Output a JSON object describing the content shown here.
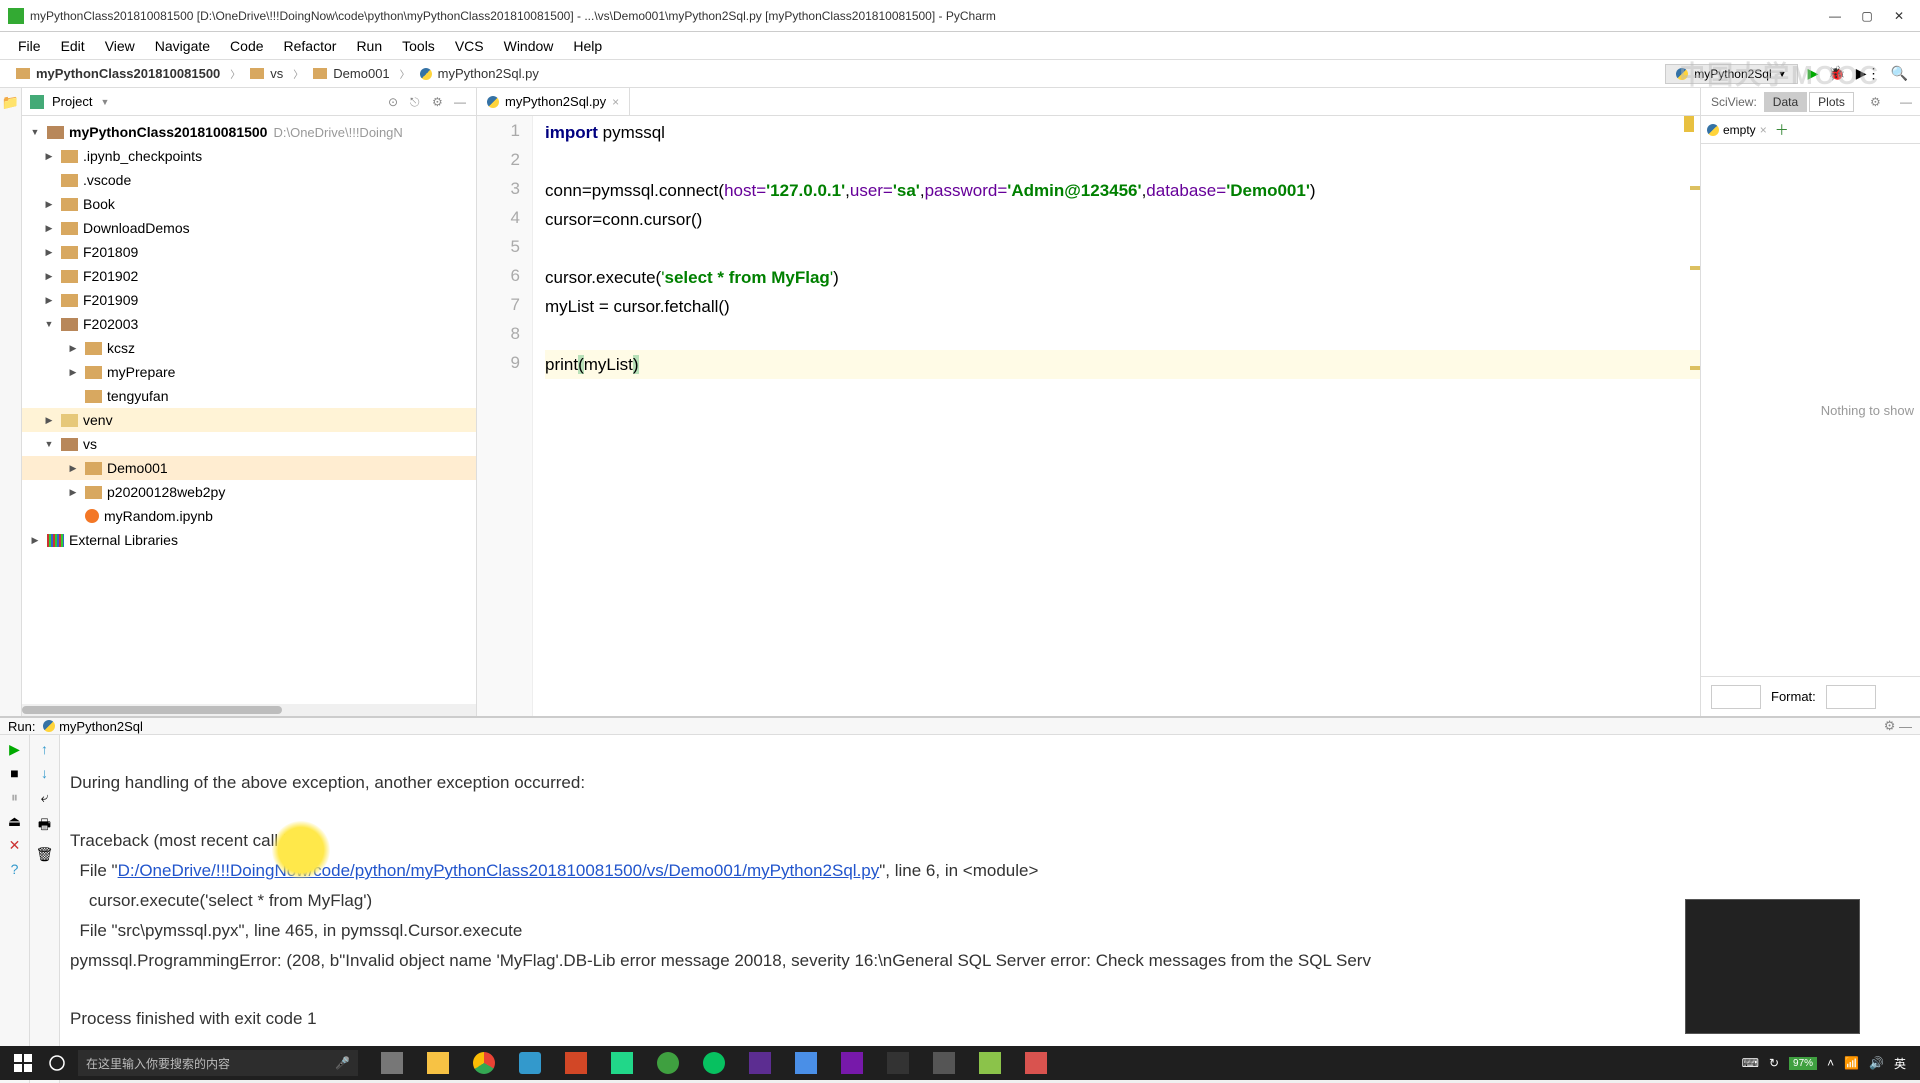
{
  "title": "myPythonClass201810081500 [D:\\OneDrive\\!!!DoingNow\\code\\python\\myPythonClass201810081500] - ...\\vs\\Demo001\\myPython2Sql.py [myPythonClass201810081500] - PyCharm",
  "menu": {
    "file": "File",
    "edit": "Edit",
    "view": "View",
    "navigate": "Navigate",
    "code": "Code",
    "refactor": "Refactor",
    "run": "Run",
    "tools": "Tools",
    "vcs": "VCS",
    "window": "Window",
    "help": "Help"
  },
  "breadcrumbs": {
    "root": "myPythonClass201810081500",
    "vs": "vs",
    "demo": "Demo001",
    "file": "myPython2Sql.py",
    "run_config": "myPython2Sql"
  },
  "sidebar": {
    "header": "Project",
    "root": {
      "name": "myPythonClass201810081500",
      "path": "D:\\OneDrive\\!!!DoingN"
    },
    "items": [
      {
        "lvl": 1,
        "icon": "folder",
        "name": ".ipynb_checkpoints",
        "chev": "right"
      },
      {
        "lvl": 1,
        "icon": "folder",
        "name": ".vscode",
        "chev": "none"
      },
      {
        "lvl": 1,
        "icon": "folder",
        "name": "Book",
        "chev": "right"
      },
      {
        "lvl": 1,
        "icon": "folder",
        "name": "DownloadDemos",
        "chev": "right"
      },
      {
        "lvl": 1,
        "icon": "folder",
        "name": "F201809",
        "chev": "right"
      },
      {
        "lvl": 1,
        "icon": "folder",
        "name": "F201902",
        "chev": "right"
      },
      {
        "lvl": 1,
        "icon": "folder",
        "name": "F201909",
        "chev": "right"
      },
      {
        "lvl": 1,
        "icon": "folder-open",
        "name": "F202003",
        "chev": "down"
      },
      {
        "lvl": 2,
        "icon": "folder",
        "name": "kcsz",
        "chev": "right"
      },
      {
        "lvl": 2,
        "icon": "folder",
        "name": "myPrepare",
        "chev": "right"
      },
      {
        "lvl": 2,
        "icon": "folder",
        "name": "tengyufan",
        "chev": "none"
      },
      {
        "lvl": 1,
        "icon": "venv",
        "name": "venv",
        "chev": "right",
        "hov": true
      },
      {
        "lvl": 1,
        "icon": "folder-open",
        "name": "vs",
        "chev": "down"
      },
      {
        "lvl": 2,
        "icon": "folder",
        "name": "Demo001",
        "chev": "right",
        "sel": true
      },
      {
        "lvl": 2,
        "icon": "folder",
        "name": "p20200128web2py",
        "chev": "right"
      },
      {
        "lvl": 2,
        "icon": "ipynb",
        "name": "myRandom.ipynb",
        "chev": "none"
      }
    ],
    "external": "External Libraries"
  },
  "editor": {
    "tab": "myPython2Sql.py",
    "lines": {
      "l1a": "import",
      "l1b": " pymssql",
      "l3_pre": "conn=pymssql.connect(",
      "l3_host": "host=",
      "l3_hostv": "'127.0.0.1'",
      "l3_c1": ",",
      "l3_user": "user=",
      "l3_userv": "'sa'",
      "l3_c2": ",",
      "l3_pass": "password=",
      "l3_passv": "'Admin@123456'",
      "l3_c3": ",",
      "l3_db": "database=",
      "l3_dbv": "'Demo001'",
      "l3_end": ")",
      "l4": "cursor=conn.cursor()",
      "l6_pre": "cursor.execute(",
      "l6_q": "'",
      "l6_sql": "select * from MyFlag",
      "l6_q2": "'",
      "l6_end": ")",
      "l7": "myList = cursor.fetchall()",
      "l9_pre": "print",
      "l9_open": "(",
      "l9_arg": "myList",
      "l9_close": ")"
    }
  },
  "sciview": {
    "label": "SciView:",
    "tabs": [
      "Data",
      "Plots"
    ],
    "empty_tab": "empty",
    "nothing": "Nothing to show",
    "format": "Format:"
  },
  "run": {
    "label": "Run:",
    "config": "myPython2Sql",
    "out": {
      "l1": "During handling of the above exception, another exception occurred:",
      "l2": "Traceback (most recent call last):",
      "l3a": "  File \"",
      "l3link": "D:/OneDrive/!!!DoingNow/code/python/myPythonClass201810081500/vs/Demo001/myPython2Sql.py",
      "l3b": "\", line 6, in <module>",
      "l4": "    cursor.execute('select * from MyFlag')",
      "l5": "  File \"src\\pymssql.pyx\", line 465, in pymssql.Cursor.execute",
      "l6": "pymssql.ProgrammingError: (208, b\"Invalid object name 'MyFlag'.DB-Lib error message 20018, severity 16:\\nGeneral SQL Server error: Check messages from the SQL Serv",
      "l7": "Process finished with exit code 1"
    }
  },
  "taskbar": {
    "search_placeholder": "在这里输入你要搜索的内容",
    "battery": "97%"
  },
  "watermark": "中国大学MOOC"
}
